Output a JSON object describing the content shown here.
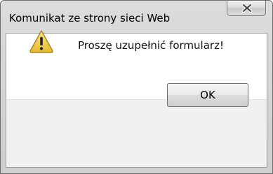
{
  "window": {
    "title": "Komunikat ze strony sieci Web"
  },
  "titlebar": {
    "close_icon": "close-icon"
  },
  "dialog": {
    "icon": "warning-icon",
    "message": "Proszę uzupełnić formularz!",
    "ok_label": "OK"
  },
  "colors": {
    "warning_yellow": "#f2d84a",
    "frame_gray": "#cfcfcf",
    "footer_bg": "#f0f0f0"
  }
}
